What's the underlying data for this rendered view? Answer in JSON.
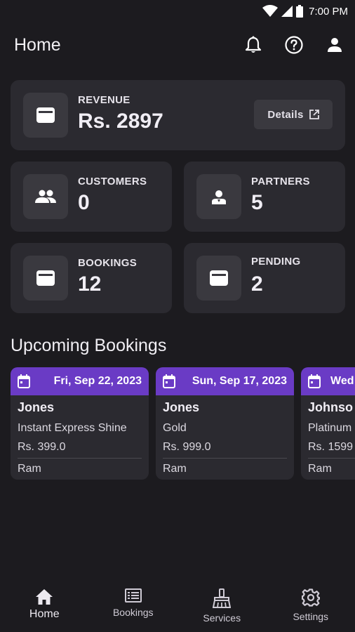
{
  "status_bar": {
    "time": "7:00 PM"
  },
  "app_bar": {
    "title": "Home"
  },
  "stats": {
    "revenue": {
      "label": "REVENUE",
      "value": "Rs. 2897",
      "details_label": "Details"
    },
    "customers": {
      "label": "CUSTOMERS",
      "value": "0"
    },
    "partners": {
      "label": "PARTNERS",
      "value": "5"
    },
    "bookings": {
      "label": "BOOKINGS",
      "value": "12"
    },
    "pending": {
      "label": "PENDING",
      "value": "2"
    }
  },
  "upcoming": {
    "title": "Upcoming Bookings",
    "items": [
      {
        "date": "Fri, Sep 22, 2023",
        "customer": "Jones",
        "service": "Instant Express Shine",
        "price": "Rs. 399.0",
        "partner": "Ram"
      },
      {
        "date": "Sun, Sep 17, 2023",
        "customer": "Jones",
        "service": "Gold",
        "price": "Rs. 999.0",
        "partner": "Ram"
      },
      {
        "date": "Wed",
        "customer": "Johnso",
        "service": "Platinum",
        "price": "Rs. 1599",
        "partner": "Ram"
      }
    ]
  },
  "bottom_nav": {
    "home": "Home",
    "bookings": "Bookings",
    "services": "Services",
    "settings": "Settings"
  },
  "colors": {
    "background": "#1c1b1f",
    "card": "#2b2a30",
    "accent": "#6a3bc5"
  }
}
